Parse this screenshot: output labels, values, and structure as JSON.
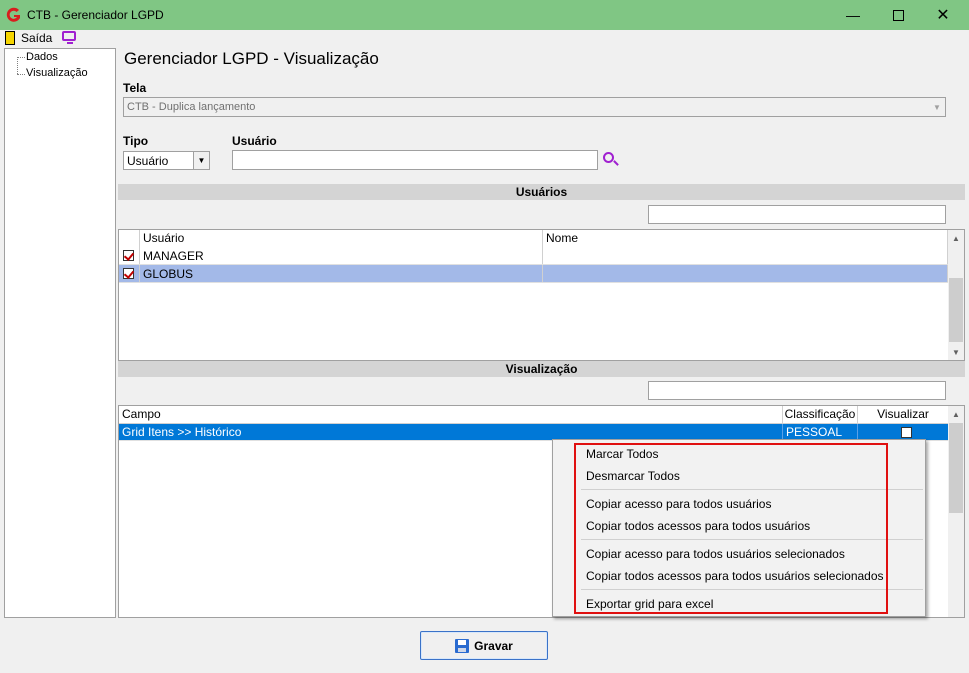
{
  "window": {
    "title": "CTB - Gerenciador LGPD"
  },
  "toolbar": {
    "exit_label": "Saída"
  },
  "tree": {
    "items": [
      "Dados",
      "Visualização"
    ]
  },
  "page": {
    "title": "Gerenciador LGPD - Visualização"
  },
  "tela": {
    "label": "Tela",
    "value": "CTB - Duplica lançamento"
  },
  "tipo": {
    "label": "Tipo",
    "value": "Usuário"
  },
  "usuario": {
    "label": "Usuário",
    "value": ""
  },
  "users_section": {
    "title": "Usuários",
    "search_value": "",
    "columns": [
      "Usuário",
      "Nome"
    ],
    "rows": [
      {
        "checked": true,
        "user": "MANAGER",
        "name": ""
      },
      {
        "checked": true,
        "user": "GLOBUS",
        "name": ""
      }
    ]
  },
  "view_section": {
    "title": "Visualização",
    "search_value": "",
    "columns": [
      "Campo",
      "Classificação",
      "Visualizar"
    ],
    "rows": [
      {
        "campo": "Grid Itens >> Histórico",
        "classificacao": "PESSOAL",
        "visualizar": false
      }
    ]
  },
  "context_menu": {
    "items": [
      "Marcar Todos",
      "Desmarcar Todos",
      "Copiar acesso para todos usuários",
      "Copiar todos acessos para todos usuários",
      "Copiar acesso para todos usuários selecionados",
      "Copiar todos acessos para todos usuários selecionados",
      "Exportar grid para excel"
    ]
  },
  "save_button": {
    "label": "Gravar"
  },
  "colors": {
    "titlebar": "#80c684",
    "selected_row": "#a3b9e8",
    "selected_row_active": "#0078d7",
    "highlight_box": "#e01010",
    "search_accent": "#a020d0"
  }
}
